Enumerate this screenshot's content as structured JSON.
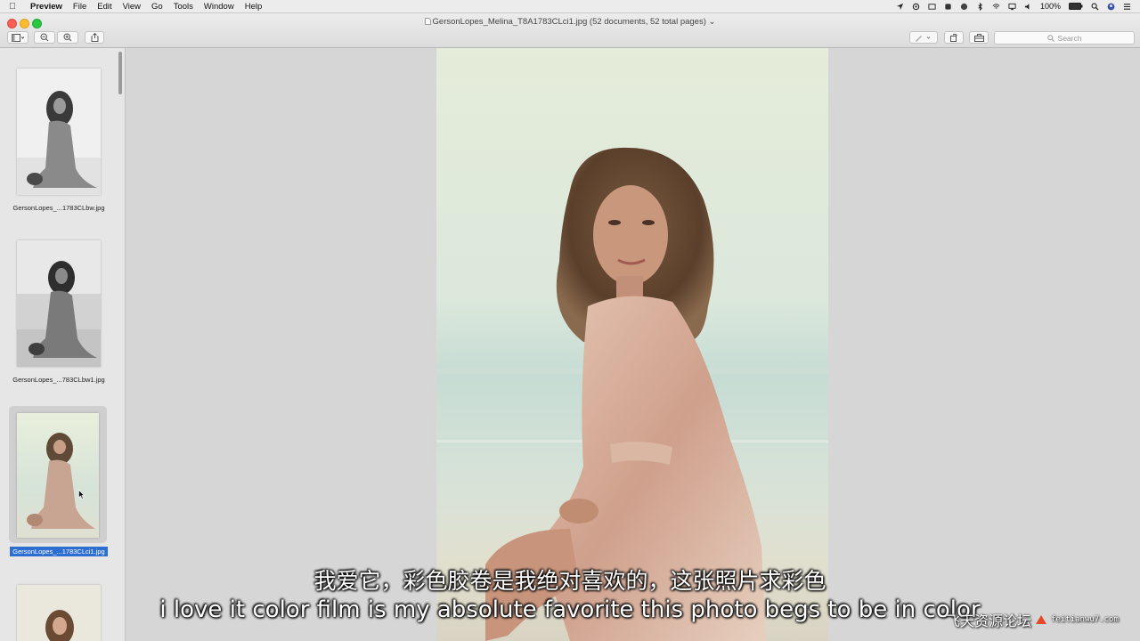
{
  "menubar": {
    "app_name": "Preview",
    "items": [
      "File",
      "Edit",
      "View",
      "Go",
      "Tools",
      "Window",
      "Help"
    ],
    "battery": "100%"
  },
  "window": {
    "title": "GersonLopes_Melina_T8A1783CLci1.jpg (52 documents, 52 total pages)"
  },
  "toolbar": {
    "search_placeholder": "Search"
  },
  "sidebar": {
    "thumbnails": [
      {
        "label": "GersonLopes_...1783CLbw.jpg",
        "style": "bw",
        "selected": false
      },
      {
        "label": "GersonLopes_...783CLbw1.jpg",
        "style": "bw",
        "selected": false
      },
      {
        "label": "GersonLopes_...1783CLci1.jpg",
        "style": "color",
        "selected": true
      },
      {
        "label": "",
        "style": "color",
        "selected": false
      }
    ]
  },
  "subtitles": {
    "chinese": "我爱它，彩色胶卷是我绝对喜欢的，这张照片求彩色",
    "english": "i love it color film is my absolute favorite this photo begs to be in color"
  },
  "watermark": {
    "text": "飞天资源论坛",
    "url": "feitianwu7.com"
  },
  "colors": {
    "selection": "#2d6ed2",
    "close": "#fc5f57",
    "minimize": "#fdbc2e",
    "zoom": "#28c840"
  }
}
